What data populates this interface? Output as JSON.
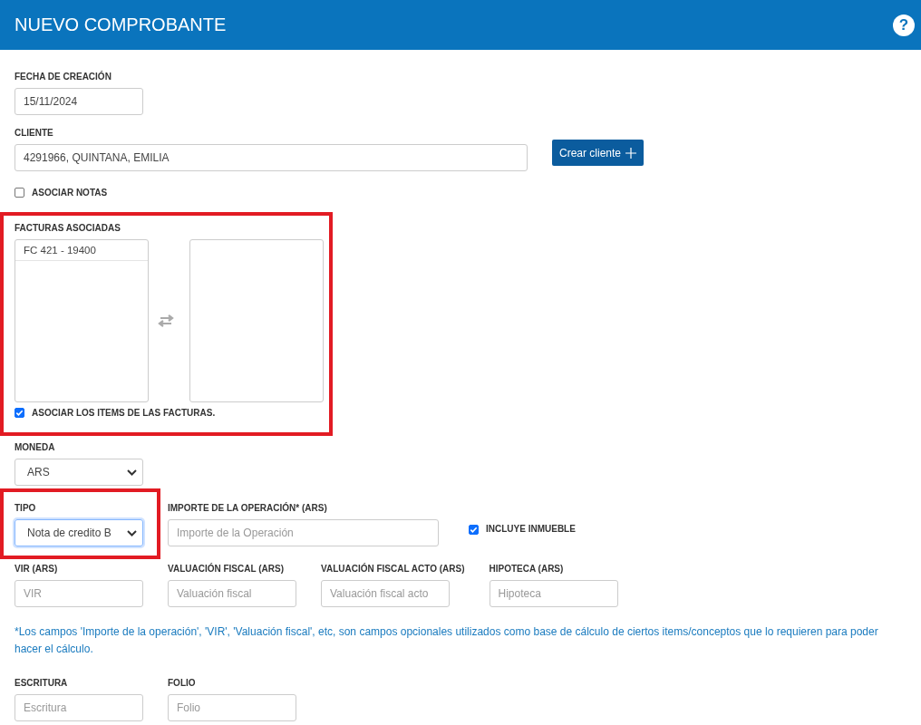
{
  "header": {
    "title": "NUEVO COMPROBANTE",
    "help": "?"
  },
  "fecha": {
    "label": "FECHA DE CREACIÓN",
    "value": "15/11/2024"
  },
  "cliente": {
    "label": "CLIENTE",
    "value": "4291966, QUINTANA, EMILIA",
    "button": "Crear cliente"
  },
  "asociar_notas": {
    "label": "ASOCIAR NOTAS",
    "checked": false
  },
  "facturas": {
    "label": "FACTURAS ASOCIADAS",
    "highlighted": true,
    "available": [
      {
        "label": "FC 421 - 19400"
      }
    ],
    "associate_items": {
      "label": "ASOCIAR LOS ITEMS DE LAS FACTURAS.",
      "checked": true
    }
  },
  "moneda": {
    "label": "MONEDA",
    "value": "ARS"
  },
  "tipo": {
    "label": "TIPO",
    "value": "Nota de credito B",
    "highlighted": true
  },
  "importe": {
    "label": "IMPORTE DE LA OPERACIÓN* (ARS)",
    "placeholder": "Importe de la Operación"
  },
  "incluye_inmueble": {
    "label": "INCLUYE INMUEBLE",
    "checked": true
  },
  "valuations": [
    {
      "label": "VIR (ARS)",
      "placeholder": "VIR"
    },
    {
      "label": "VALUACIÓN FISCAL (ARS)",
      "placeholder": "Valuación fiscal"
    },
    {
      "label": "VALUACIÓN FISCAL ACTO (ARS)",
      "placeholder": "Valuación fiscal acto"
    },
    {
      "label": "HIPOTECA (ARS)",
      "placeholder": "Hipoteca"
    }
  ],
  "note": "*Los campos 'Importe de la operación', 'VIR', 'Valuación fiscal', etc, son campos opcionales utilizados como base de cálculo de ciertos items/conceptos que lo requieren para poder hacer el cálculo.",
  "extra": [
    {
      "label": "ESCRITURA",
      "placeholder": "Escritura"
    },
    {
      "label": "FOLIO",
      "placeholder": "Folio"
    }
  ]
}
